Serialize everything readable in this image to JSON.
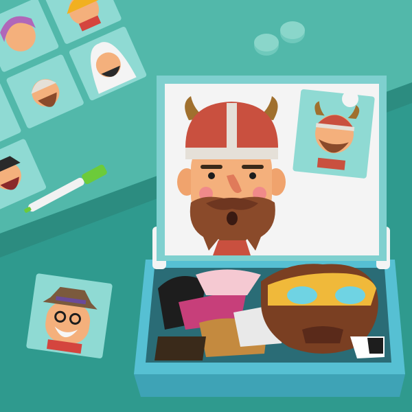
{
  "scene": {
    "description_free": true,
    "palette": {
      "background": "#3aa89c",
      "background_dark": "#2b8f84",
      "platform_top": "#62c3b6",
      "board_frame": "#7fd0cf",
      "board_white": "#f4f4f4",
      "box_tray": "#5cc6d6",
      "card_bg": "#8fdad3",
      "skin": "#f4b07c",
      "viking_helmet": "#e5e0d8",
      "helmet_red": "#c9503f",
      "horn": "#a0702e",
      "beard": "#8a4a2a",
      "marker_green": "#6ccb3a",
      "marker_white": "#f2f2f2",
      "magnet_dot": "#7fd0c4"
    },
    "icons": [
      "viking-face-icon",
      "construction-worker-face-icon",
      "sheikh-face-icon",
      "pirate-face-icon",
      "native-chief-face-icon",
      "woman-face-icon",
      "grandpa-fedora-face-icon",
      "marker-pen-icon",
      "magnet-dot-icon"
    ]
  }
}
